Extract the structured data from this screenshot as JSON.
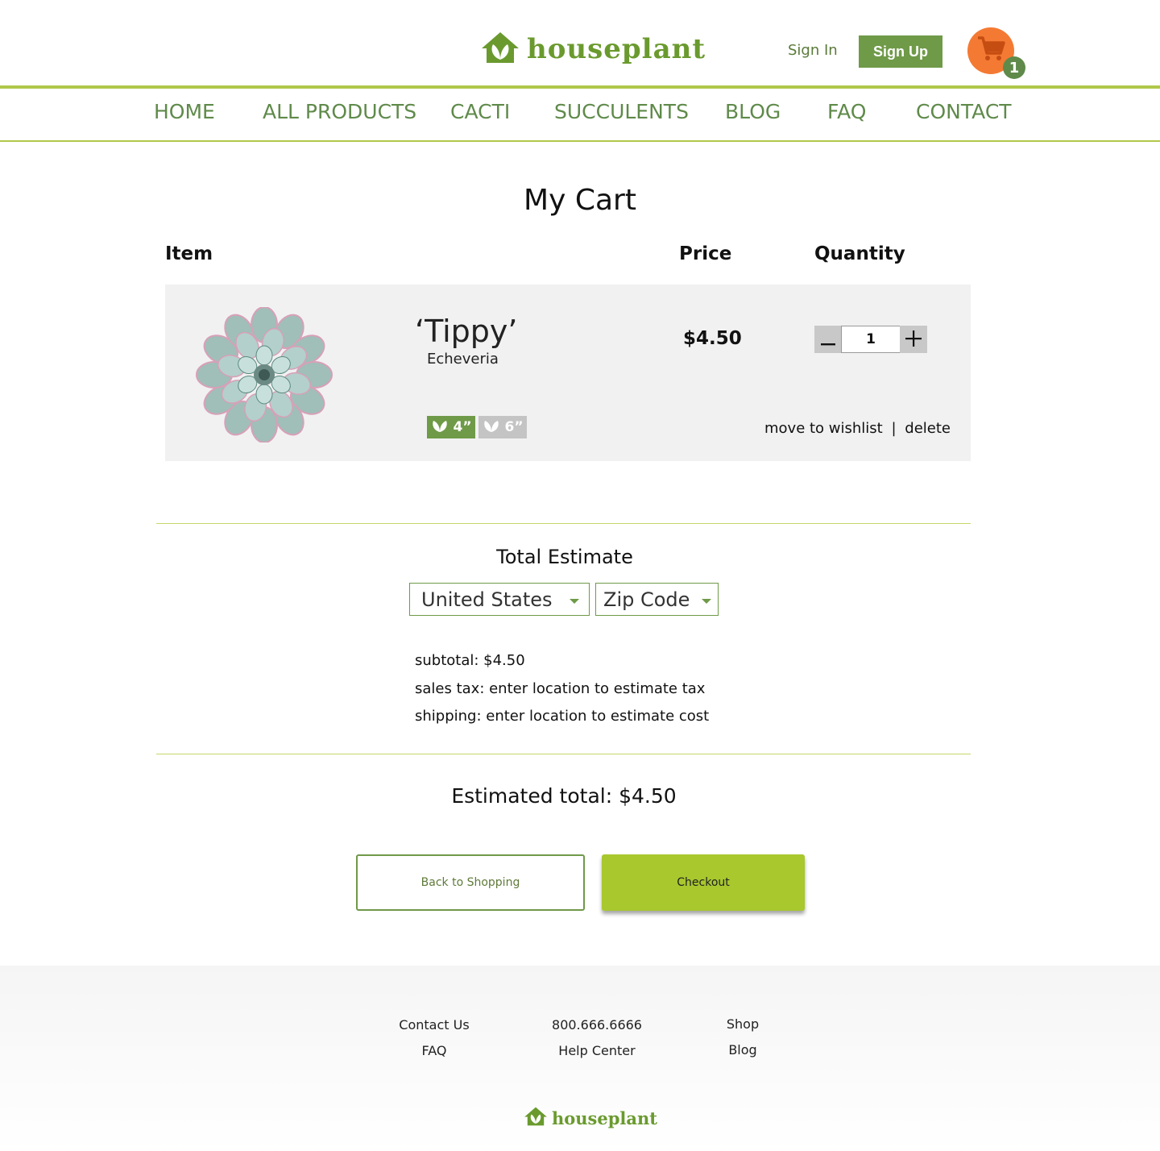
{
  "header": {
    "brand": "houseplant",
    "sign_in": "Sign In",
    "sign_up": "Sign Up",
    "cart_count": "1",
    "brand_color": "#6a9a2e",
    "cart_color": "#f47a34",
    "icons": {
      "logo": "house-leaf-icon",
      "cart": "shopping-cart-icon"
    }
  },
  "nav": {
    "items": [
      {
        "label": "HOME"
      },
      {
        "label": "ALL PRODUCTS"
      },
      {
        "label": "CACTI"
      },
      {
        "label": "SUCCULENTS"
      },
      {
        "label": "BLOG"
      },
      {
        "label": "FAQ"
      },
      {
        "label": "CONTACT"
      }
    ]
  },
  "cart": {
    "title": "My Cart",
    "columns": {
      "item": "Item",
      "price": "Price",
      "quantity": "Quantity"
    },
    "items": [
      {
        "name": "‘Tippy’",
        "type": "Echeveria",
        "price": "$4.50",
        "quantity": "1",
        "sizes": [
          {
            "label": "4”",
            "selected": true
          },
          {
            "label": "6”",
            "selected": false
          }
        ],
        "actions": {
          "wishlist": "move to wishlist",
          "separator": "|",
          "delete": "delete"
        }
      }
    ]
  },
  "estimate": {
    "title": "Total Estimate",
    "country": "United States",
    "zip": "Zip Code",
    "subtotal": "subtotal: $4.50",
    "sales_tax": "sales tax: enter location to estimate tax",
    "shipping": "shipping: enter location to estimate cost",
    "estimated_total": "Estimated total: $4.50"
  },
  "buttons": {
    "back": "Back to Shopping",
    "checkout": "Checkout"
  },
  "footer": {
    "col1": [
      "Contact Us",
      "FAQ"
    ],
    "col2": [
      "800.666.6666",
      "Help Center"
    ],
    "col3": [
      "Shop",
      "Blog"
    ],
    "brand": "houseplant"
  }
}
